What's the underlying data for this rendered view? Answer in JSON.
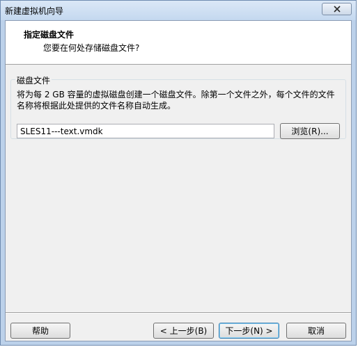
{
  "window": {
    "title": "新建虚拟机向导"
  },
  "header": {
    "title": "指定磁盘文件",
    "subtitle": "您要在何处存储磁盘文件?"
  },
  "disk_file_group": {
    "label": "磁盘文件",
    "description": "将为每 2 GB 容量的虚拟磁盘创建一个磁盘文件。除第一个文件之外，每个文件的文件名称将根据此处提供的文件名称自动生成。",
    "path_value": "SLES11---text.vmdk",
    "browse_label": "浏览(R)..."
  },
  "footer": {
    "help_label": "帮助",
    "back_label": "< 上一步(B)",
    "next_label": "下一步(N) >",
    "cancel_label": "取消"
  },
  "icons": {
    "close": "close-icon"
  }
}
